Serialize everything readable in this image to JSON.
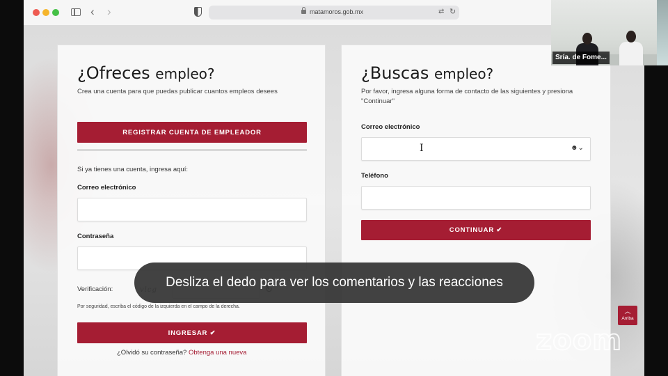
{
  "browser": {
    "url": "matamoros.gob.mx"
  },
  "employer_card": {
    "title_part1": "¿Ofreces",
    "title_part2": "empleo?",
    "subtitle": "Crea una cuenta para que puedas publicar cuantos empleos desees",
    "register_button": "REGISTRAR CUENTA DE EMPLEADOR",
    "login_prompt": "Si ya tienes una cuenta, ingresa aquí:",
    "email_label": "Correo electrónico",
    "password_label": "Contraseña",
    "verification_label": "Verificación:",
    "security_note": "Por seguridad, escriba el código de la izquierda en el campo de la derecha.",
    "login_button": "INGRESAR ✔",
    "forgot_text": "¿Olvidó su contraseña?",
    "forgot_link": "Obtenga una nueva"
  },
  "seeker_card": {
    "title_part1": "¿Buscas",
    "title_part2": "empleo?",
    "subtitle": "Por favor, ingresa alguna forma de contacto de las siguientes y presiona \"Continuar\"",
    "email_label": "Correo electrónico",
    "phone_label": "Teléfono",
    "continue_button": "CONTINUAR ✔"
  },
  "scroll_top": {
    "label": "Arriba",
    "icon": "chevron-up-icon"
  },
  "zoom": {
    "watermark": "zoom",
    "participant_name": "Sría. de Fome...",
    "toast": "Desliza el dedo para ver los comentarios y las reacciones"
  },
  "colors": {
    "brand": "#a51d33"
  }
}
